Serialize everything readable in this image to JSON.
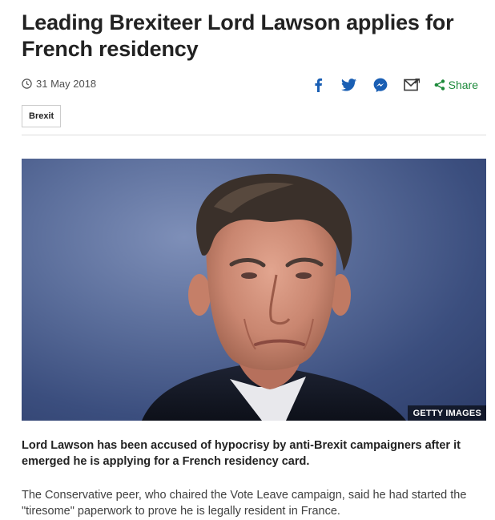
{
  "article": {
    "headline": "Leading Brexiteer Lord Lawson applies for French residency",
    "date": "31 May 2018",
    "tag": "Brexit",
    "image_caption": "GETTY IMAGES",
    "summary": "Lord Lawson has been accused of hypocrisy by anti-Brexit campaigners after it emerged he is applying for a French residency card.",
    "body_paragraph": "The Conservative peer, who chaired the Vote Leave campaign, said he had started the \"tiresome\" paperwork to prove he is legally resident in France."
  },
  "share": {
    "icons": [
      "facebook-icon",
      "twitter-icon",
      "messenger-icon",
      "email-icon",
      "share-icon"
    ],
    "share_label": "Share",
    "accent": "#1d8a3b",
    "icon_color": "#1a5fb4"
  }
}
